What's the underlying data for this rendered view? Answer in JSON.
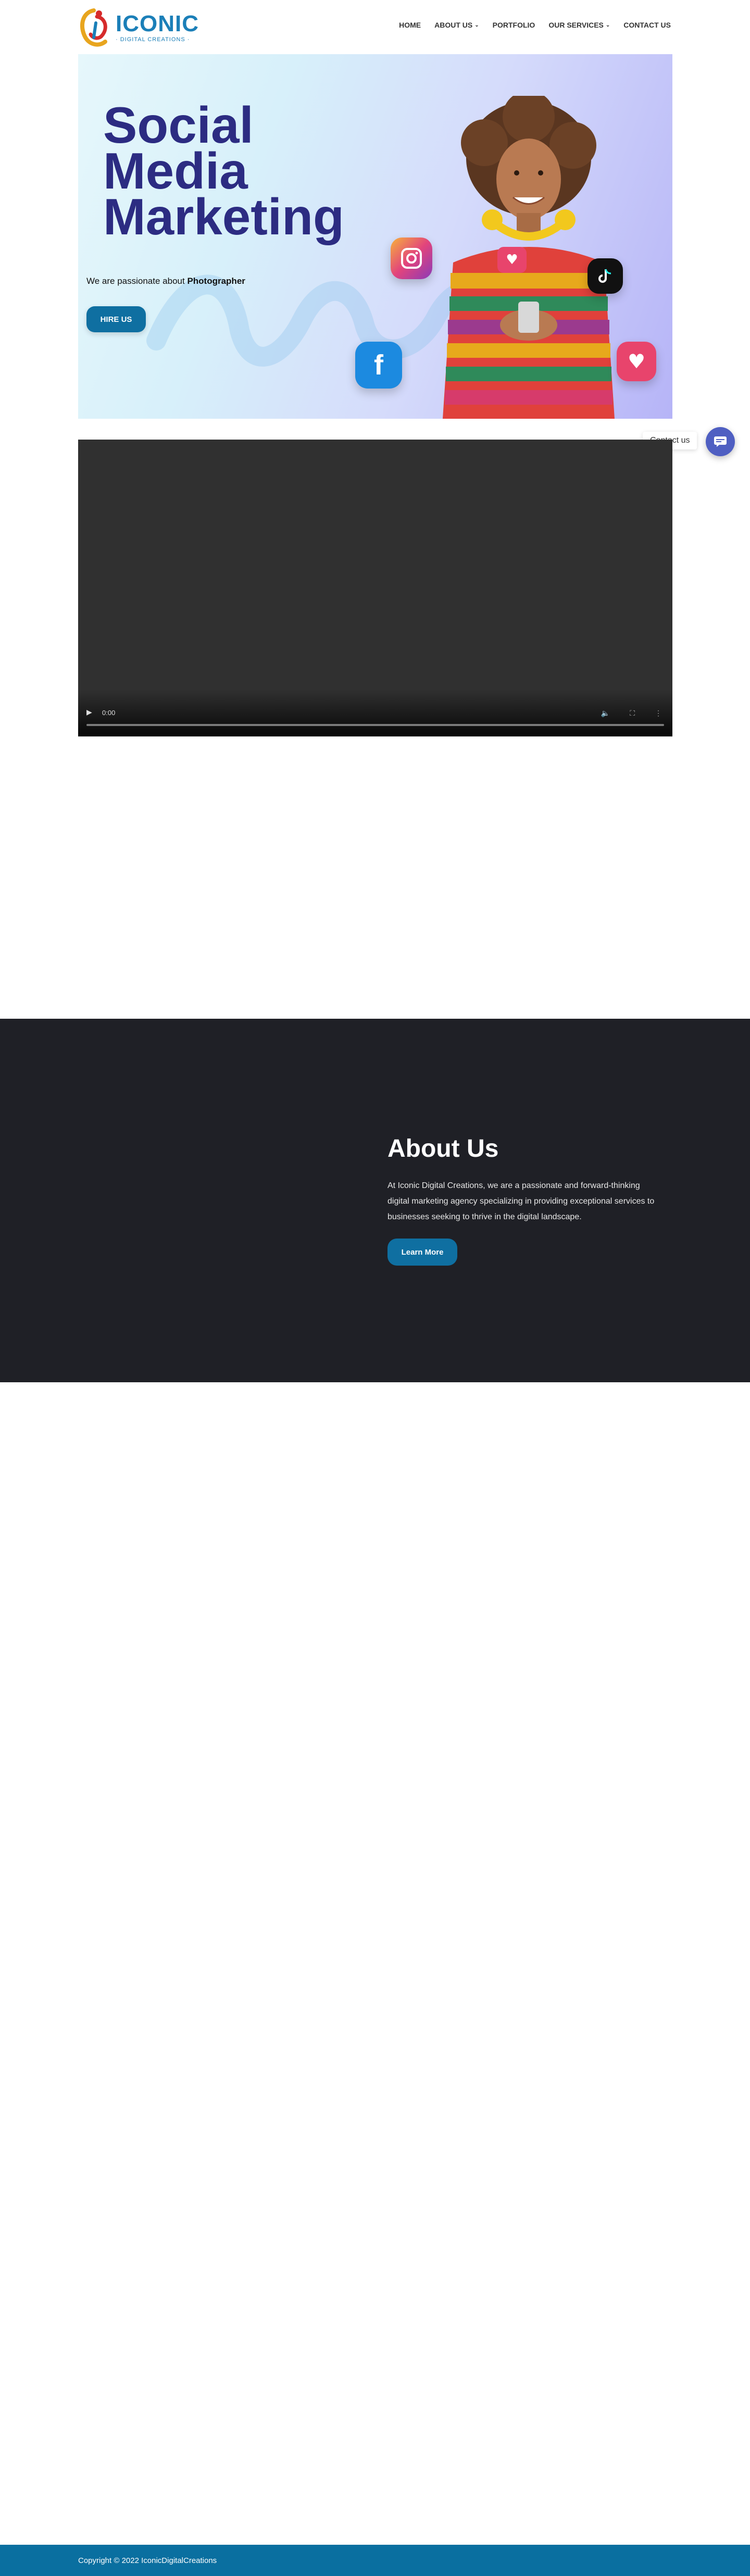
{
  "header": {
    "logo_text": "ICONIC",
    "logo_sub": "· DIGITAL CREATIONS ·",
    "nav": [
      {
        "label": "HOME",
        "dropdown": false
      },
      {
        "label": "ABOUT US",
        "dropdown": true
      },
      {
        "label": "PORTFOLIO",
        "dropdown": false
      },
      {
        "label": "OUR SERVICES",
        "dropdown": true
      },
      {
        "label": "CONTACT US",
        "dropdown": false
      }
    ]
  },
  "hero": {
    "title_lines": [
      "Social",
      "Media",
      "Marketing"
    ],
    "tagline_prefix": "We are passionate about ",
    "tagline_bold": "Photographer",
    "button_label": "HIRE US"
  },
  "video": {
    "time": "0:00"
  },
  "contact_widget": {
    "label": "Contact us"
  },
  "about": {
    "title": "About Us",
    "text": "At Iconic Digital Creations, we are a passionate and forward-thinking digital marketing agency specializing in providing exceptional services to businesses seeking to thrive in the digital landscape.",
    "button_label": "Learn More"
  },
  "footer": {
    "copyright": "Copyright © 2022 IconicDigitalCreations"
  },
  "colors": {
    "brand_blue": "#0f6fa1",
    "title_navy": "#2c2c82",
    "about_bg": "#1f2026",
    "footer_bg": "#0a6fa0"
  }
}
